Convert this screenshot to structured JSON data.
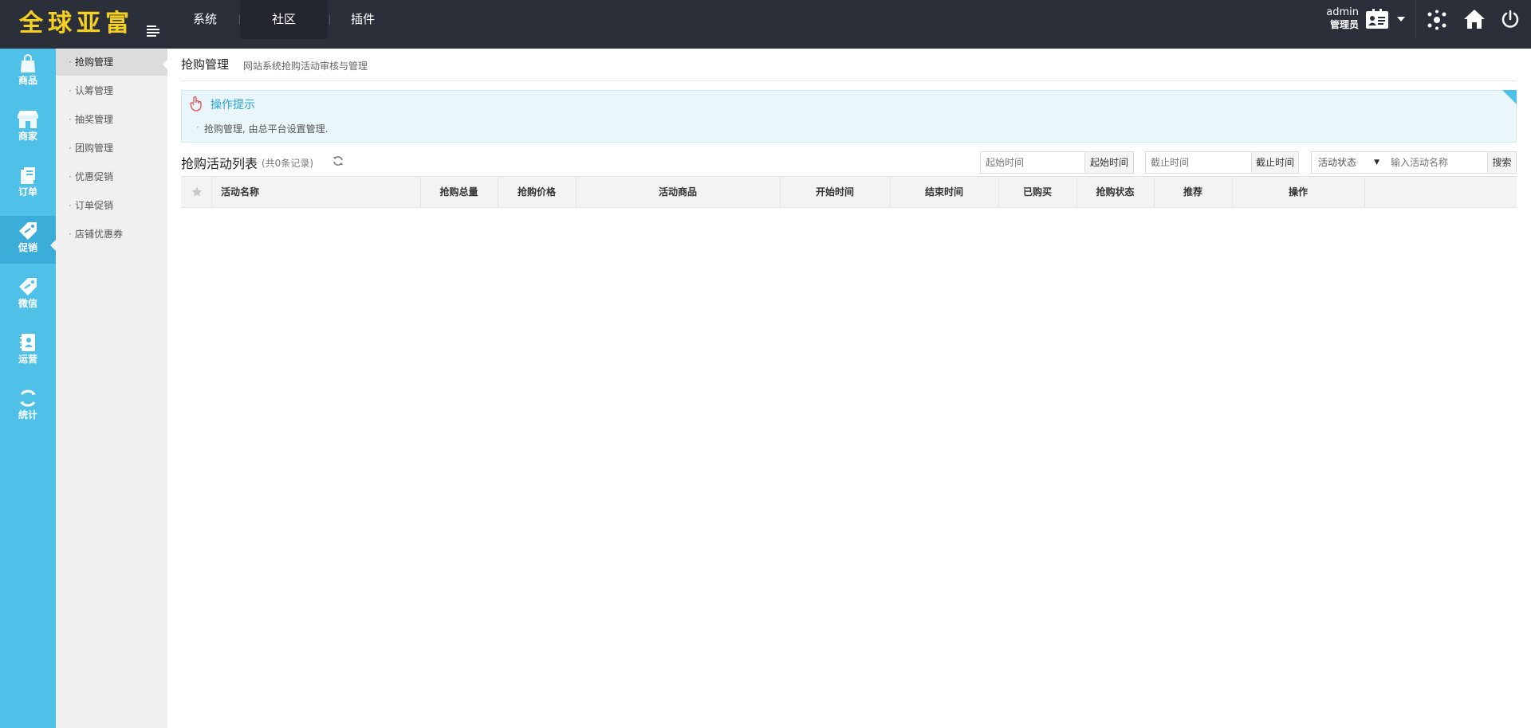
{
  "brand": {
    "logo_text": "全球亚富",
    "logo_color": "#f5d020"
  },
  "topnav": {
    "items": [
      {
        "label": "系统"
      },
      {
        "label": "社区",
        "active": true
      },
      {
        "label": "插件"
      }
    ]
  },
  "user": {
    "name": "admin",
    "role": "管理员"
  },
  "icons": {
    "menu_toggle": "list-indent-icon",
    "card": "id-card-icon",
    "hub": "network-hub-icon",
    "home": "home-icon",
    "power": "power-icon"
  },
  "leftnav": {
    "items": [
      {
        "label": "商品",
        "icon": "shopping-bag-icon"
      },
      {
        "label": "商家",
        "icon": "storefront-icon"
      },
      {
        "label": "订单",
        "icon": "order-icon"
      },
      {
        "label": "促销",
        "icon": "price-tag-icon",
        "active": true
      },
      {
        "label": "微信",
        "icon": "wechat-icon"
      },
      {
        "label": "运营",
        "icon": "operations-icon"
      },
      {
        "label": "统计",
        "icon": "statistics-icon"
      }
    ],
    "bg_color": "#4fc0e8"
  },
  "subnav": {
    "items": [
      {
        "label": "抢购管理",
        "active": true
      },
      {
        "label": "认筹管理"
      },
      {
        "label": "抽奖管理"
      },
      {
        "label": "团购管理"
      },
      {
        "label": "优惠促销"
      },
      {
        "label": "订单促销"
      },
      {
        "label": "店铺优惠券"
      }
    ]
  },
  "page": {
    "title": "抢购管理",
    "subtitle": "网站系统抢购活动审核与管理"
  },
  "tips": {
    "title": "操作提示",
    "items": [
      "抢购管理, 由总平台设置管理."
    ],
    "accent": "#2aa4d5"
  },
  "list": {
    "title": "抢购活动列表",
    "count": "(共0条记录)"
  },
  "filters": {
    "start_placeholder": "起始时间",
    "start_button": "起始时间",
    "end_placeholder": "截止时间",
    "end_button": "截止时间",
    "status_selected": "活动状态",
    "name_placeholder": "输入活动名称",
    "search_button": "搜索"
  },
  "table": {
    "columns": [
      "活动名称",
      "抢购总量",
      "抢购价格",
      "活动商品",
      "开始时间",
      "结束时间",
      "已购买",
      "抢购状态",
      "推荐",
      "操作"
    ],
    "rows": []
  }
}
